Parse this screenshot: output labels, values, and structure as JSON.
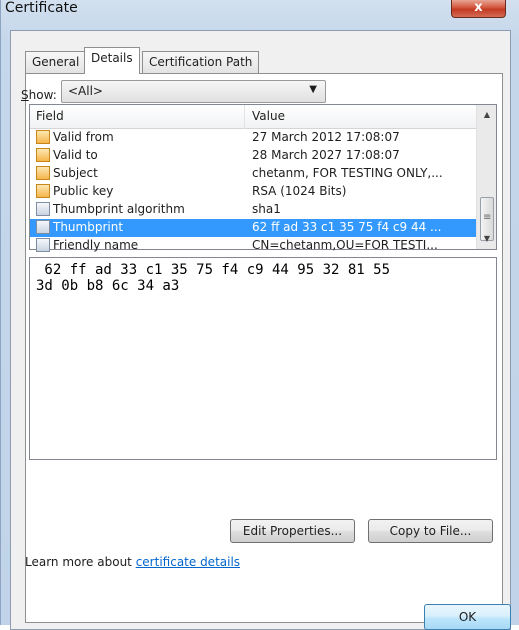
{
  "window": {
    "title": "Certificate",
    "close_glyph": "x"
  },
  "tabs": [
    {
      "label": "General"
    },
    {
      "label": "Details"
    },
    {
      "label": "Certification Path"
    }
  ],
  "show": {
    "label_prefix": "S",
    "label_rest": "how:",
    "selected": "<All>",
    "arrow_glyph": "▼"
  },
  "list": {
    "headers": {
      "field": "Field",
      "value": "Value"
    },
    "rows": [
      {
        "field": "Valid from",
        "value": "27 March 2012 17:08:07",
        "icon": "certificate-property-icon"
      },
      {
        "field": "Valid to",
        "value": "28 March 2027 17:08:07",
        "icon": "certificate-property-icon"
      },
      {
        "field": "Subject",
        "value": "chetanm, FOR TESTING ONLY,...",
        "icon": "certificate-property-icon"
      },
      {
        "field": "Public key",
        "value": "RSA (1024 Bits)",
        "icon": "certificate-property-icon"
      },
      {
        "field": "Thumbprint algorithm",
        "value": "sha1",
        "icon": "document-property-icon"
      },
      {
        "field": "Thumbprint",
        "value": "62 ff ad 33 c1 35 75 f4 c9 44 ...",
        "icon": "document-property-icon",
        "selected": true
      },
      {
        "field": "Friendly name",
        "value": "CN=chetanm,OU=FOR TESTI...",
        "icon": "document-property-icon"
      }
    ],
    "scroll_up_glyph": "▲",
    "scroll_down_glyph": "▼",
    "scroll_grip_glyph": "≡"
  },
  "value_text": " 62 ff ad 33 c1 35 75 f4 c9 44 95 32 81 55\n3d 0b b8 6c 34 a3",
  "buttons": {
    "edit_properties": "Edit Properties...",
    "copy_to_file": "Copy to File...",
    "ok": "OK"
  },
  "learn_more": {
    "text": "Learn more about ",
    "link": "certificate details"
  },
  "colors": {
    "selection": "#3399ff",
    "link": "#0066cc",
    "close_button": "#c9452d"
  }
}
